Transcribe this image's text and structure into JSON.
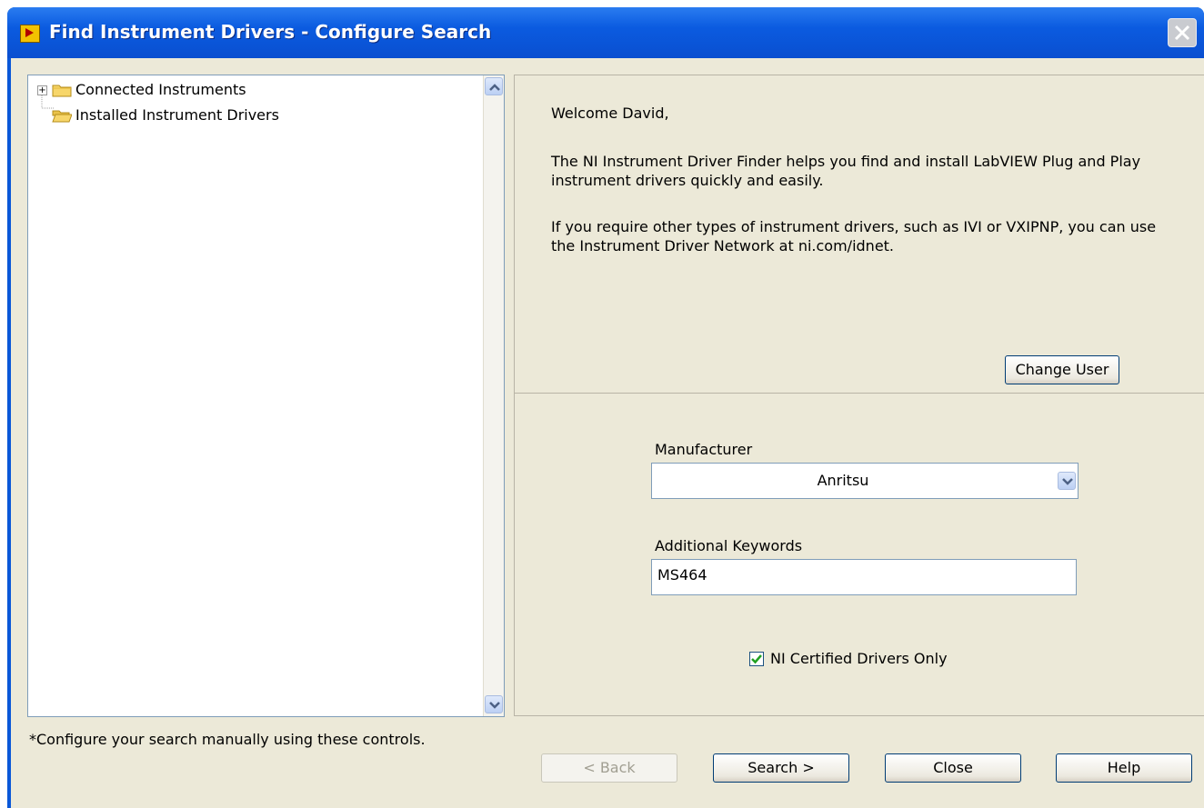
{
  "window": {
    "title": "Find Instrument Drivers - Configure Search"
  },
  "tree": {
    "items": [
      {
        "label": "Connected Instruments",
        "expander": "+"
      },
      {
        "label": "Installed Instrument Drivers"
      }
    ]
  },
  "info": {
    "welcome": "Welcome David,",
    "paragraph1": "The NI Instrument Driver Finder helps you find and install LabVIEW Plug and Play instrument drivers quickly and easily.",
    "paragraph2": "If you require other types of instrument drivers, such as IVI or VXIPNP, you can use the Instrument Driver Network at ni.com/idnet.",
    "change_user_label": "Change User"
  },
  "search": {
    "manufacturer_label": "Manufacturer",
    "manufacturer_value": "Anritsu",
    "keywords_label": "Additional Keywords",
    "keywords_value": "MS464",
    "certified_label": "NI Certified Drivers Only",
    "certified_checked": true
  },
  "footer": {
    "note": "*Configure your search manually using these controls.",
    "back_label": "< Back",
    "search_label": "Search >",
    "close_label": "Close",
    "help_label": "Help"
  },
  "colors": {
    "titlebar": "#0a57d8",
    "dialog_bg": "#ece9d8",
    "check": "#21a121"
  },
  "icons": {
    "app": "labview-app-icon",
    "folder": "folder-icon",
    "close": "close-icon",
    "scroll_up": "chevron-up-icon",
    "scroll_down": "chevron-down-icon",
    "dropdown": "chevron-down-icon",
    "check": "check-icon"
  }
}
